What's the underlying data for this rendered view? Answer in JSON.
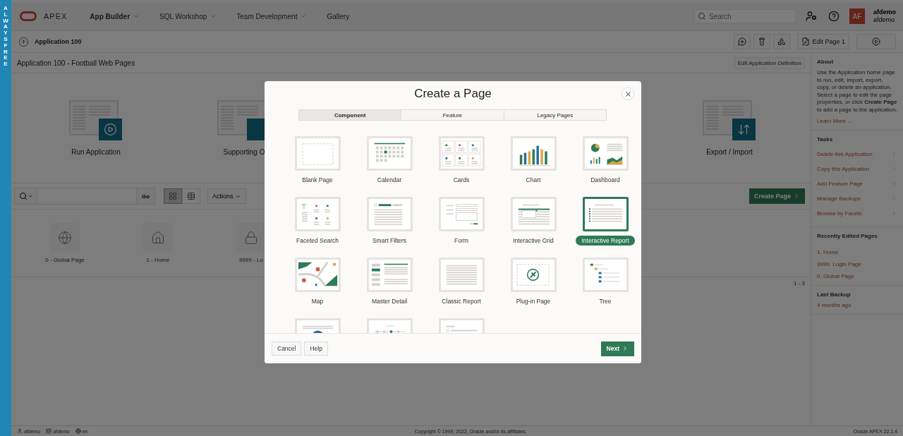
{
  "side_strip": {
    "label": "ALWAYSFREE"
  },
  "top_nav": {
    "logo": "APEX",
    "menus": [
      {
        "label": "App Builder",
        "selected": true,
        "has_menu": true
      },
      {
        "label": "SQL Workshop",
        "selected": false,
        "has_menu": true
      },
      {
        "label": "Team Development",
        "selected": false,
        "has_menu": true
      },
      {
        "label": "Gallery",
        "selected": false,
        "has_menu": false
      }
    ],
    "search": {
      "placeholder": "Search"
    },
    "user": {
      "initials": "AF",
      "name": "afdemo",
      "workspace": "afdemo"
    }
  },
  "breadcrumb": {
    "title": "Application 100",
    "buttons": [
      {
        "kind": "comment"
      },
      {
        "kind": "flashlight"
      },
      {
        "kind": "shapes"
      },
      {
        "kind": "edit",
        "label": "Edit Page 1"
      },
      {
        "kind": "run"
      }
    ]
  },
  "app": {
    "title": "Application 100 - Football Web Pages",
    "edit_button": "Edit Application Definition",
    "tasks": [
      {
        "kind": "run",
        "label": "Run Application"
      },
      {
        "kind": "supporting",
        "label": "Supporting O"
      },
      {
        "kind": "export",
        "label": "Export / Import"
      }
    ]
  },
  "toolbar": {
    "go": "Go",
    "views": [
      {
        "kind": "grid",
        "selected": true
      },
      {
        "kind": "table",
        "selected": false
      }
    ],
    "actions": "Actions",
    "create_page": "Create Page",
    "pagination": "1 - 3"
  },
  "pages": [
    {
      "kind": "globe",
      "label": "0 - Global Page"
    },
    {
      "kind": "home",
      "label": "1 - Home"
    },
    {
      "kind": "lock",
      "label": "9999 - Lo"
    }
  ],
  "about": {
    "heading": "About",
    "text": "Use the Application home page to run, edit, import, export, copy, or delete an application. Select a page to edit the page properties, or click **Create Page** to add a page to the application.",
    "link": "Learn More ..."
  },
  "tasks": {
    "heading": "Tasks",
    "items": [
      "Delete this Application",
      "Copy this Application",
      "Add Feature Page",
      "Manage Backups",
      "Browse by Facets"
    ]
  },
  "recent": {
    "heading": "Recently Edited Pages",
    "items": [
      "1. Home",
      "9999. Login Page",
      "0. Global Page"
    ]
  },
  "backup": {
    "heading": "Last Backup",
    "value": "4 months ago"
  },
  "footer": {
    "user": "afdemo",
    "schema": "afdemo",
    "language": "en",
    "copyright": "Copyright © 1999, 2022, Oracle and/or its affiliates.",
    "version": "Oracle APEX 22.1.4"
  },
  "dialog": {
    "title": "Create a Page",
    "tabs": [
      {
        "label": "Component",
        "selected": true
      },
      {
        "label": "Feature",
        "selected": false
      },
      {
        "label": "Legacy Pages",
        "selected": false
      }
    ],
    "tiles": [
      {
        "kind": "blank",
        "label": "Blank Page",
        "selected": false
      },
      {
        "kind": "calendar",
        "label": "Calendar",
        "selected": false
      },
      {
        "kind": "cards",
        "label": "Cards",
        "selected": false
      },
      {
        "kind": "chart",
        "label": "Chart",
        "selected": false
      },
      {
        "kind": "dashboard",
        "label": "Dashboard",
        "selected": false
      },
      {
        "kind": "faceted",
        "label": "Faceted Search",
        "selected": false
      },
      {
        "kind": "smartfilters",
        "label": "Smart Filters",
        "selected": false
      },
      {
        "kind": "form",
        "label": "Form",
        "selected": false
      },
      {
        "kind": "grid",
        "label": "Interactive Grid",
        "selected": false
      },
      {
        "kind": "report",
        "label": "Interactive Report",
        "selected": true
      },
      {
        "kind": "map",
        "label": "Map",
        "selected": false
      },
      {
        "kind": "masterdetail",
        "label": "Master Detail",
        "selected": false
      },
      {
        "kind": "classic",
        "label": "Classic Report",
        "selected": false
      },
      {
        "kind": "plugin",
        "label": "Plug-in Page",
        "selected": false
      },
      {
        "kind": "tree",
        "label": "Tree",
        "selected": false
      },
      {
        "kind": "avatar",
        "selected": false
      },
      {
        "kind": "wizard",
        "selected": false
      },
      {
        "kind": "search",
        "selected": false
      }
    ],
    "cancel": "Cancel",
    "help": "Help",
    "next": "Next"
  }
}
